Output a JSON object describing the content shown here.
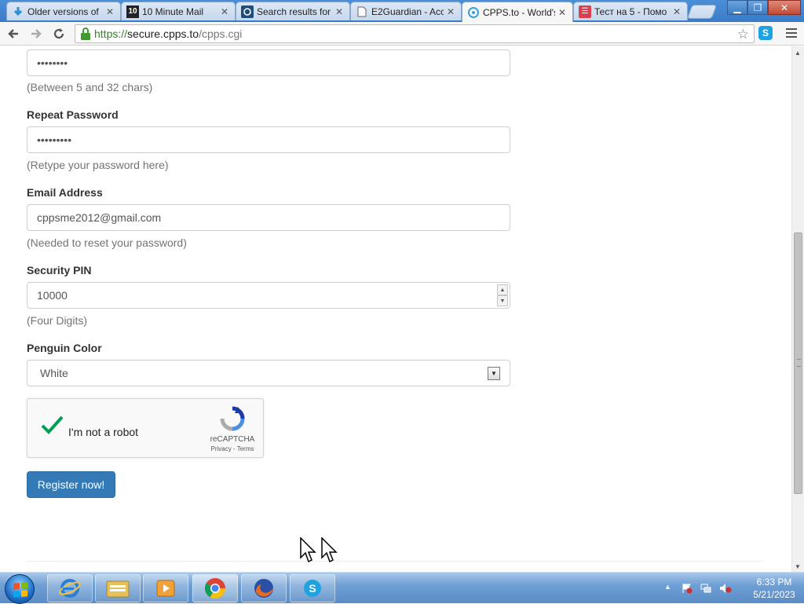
{
  "browser": {
    "tabs": [
      {
        "title": "Older versions of",
        "icon": "download-arrow-icon",
        "active": false
      },
      {
        "title": "10 Minute Mail",
        "icon": "ten-minute-mail-icon",
        "active": false
      },
      {
        "title": "Search results for",
        "icon": "search-site-icon",
        "active": false
      },
      {
        "title": "E2Guardian - Acc",
        "icon": "document-icon",
        "active": false
      },
      {
        "title": "CPPS.to - World's",
        "icon": "cpps-icon",
        "active": true
      },
      {
        "title": "Тест на 5 - Помо",
        "icon": "test-site-icon",
        "active": false
      }
    ],
    "url": {
      "protocol": "https://",
      "host": "secure.cpps.to",
      "path": "/cpps.cgi"
    }
  },
  "form": {
    "password": {
      "masked_value": "••••••••",
      "help": "(Between 5 and 32 chars)"
    },
    "repeat_password": {
      "label": "Repeat Password",
      "masked_value": "•••••••••",
      "help": "(Retype your password here)"
    },
    "email": {
      "label": "Email Address",
      "value": "cppsme2012@gmail.com",
      "help": "(Needed to reset your password)"
    },
    "security_pin": {
      "label": "Security PIN",
      "value": "10000",
      "help": "(Four Digits)"
    },
    "penguin_color": {
      "label": "Penguin Color",
      "selected": "White"
    },
    "recaptcha": {
      "label": "I'm not a robot",
      "checked": true,
      "brand": "reCAPTCHA",
      "links": "Privacy - Terms"
    },
    "submit_label": "Register now!"
  },
  "taskbar": {
    "apps": [
      "internet-explorer-icon",
      "file-explorer-icon",
      "media-player-icon",
      "chrome-icon",
      "firefox-icon",
      "skype-icon"
    ],
    "time": "6:33 PM",
    "date": "5/21/2023"
  },
  "colors": {
    "primary_button": "#337ab7",
    "recaptcha_check": "#009e55"
  }
}
